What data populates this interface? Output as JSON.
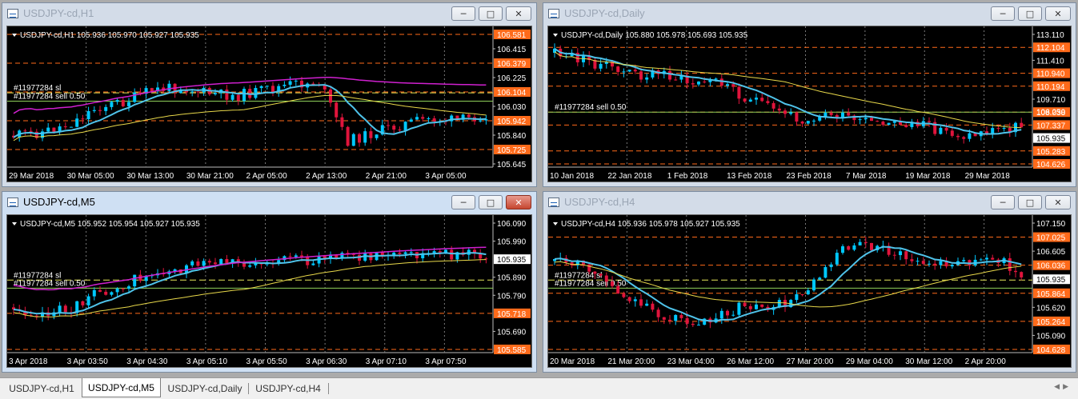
{
  "windows": [
    {
      "title": "USDJPY-cd,H1",
      "active": false,
      "info": "USDJPY-cd,H1  105.936 105.970 105.927 105.935",
      "price_labels": [
        "106.581",
        "106.415",
        "106.379",
        "106.225",
        "106.104",
        "106.030",
        "105.942",
        "105.840",
        "105.725",
        "105.645"
      ],
      "price_label_kinds": [
        "box",
        "plain",
        "box",
        "plain",
        "box",
        "plain",
        "box",
        "plain",
        "box",
        "plain"
      ],
      "time_labels": [
        "29 Mar 2018",
        "30 Mar 05:00",
        "30 Mar 13:00",
        "30 Mar 21:00",
        "2 Apr 05:00",
        "2 Apr 13:00",
        "2 Apr 21:00",
        "3 Apr 05:00"
      ],
      "order_lines": [
        "#11977284 sl",
        "#11977284 sell 0.50"
      ],
      "seed": 11,
      "trend": [
        0.85,
        0.82,
        0.75,
        0.6,
        0.55,
        0.45,
        0.42,
        0.48,
        0.5,
        0.45,
        0.4,
        0.38,
        0.9,
        0.82,
        0.75,
        0.7,
        0.72,
        0.66
      ]
    },
    {
      "title": "USDJPY-cd,Daily",
      "active": false,
      "info": "USDJPY-cd,Daily  105.880 105.978 105.693 105.935",
      "price_labels": [
        "113.110",
        "112.104",
        "111.410",
        "110.940",
        "110.194",
        "109.710",
        "108.038",
        "107.337",
        "105.935",
        "105.283",
        "104.626"
      ],
      "price_label_kinds": [
        "plain",
        "box",
        "plain",
        "box",
        "box",
        "plain",
        "box",
        "box",
        "white",
        "box",
        "box"
      ],
      "extra_labels": [
        "106.250"
      ],
      "time_labels": [
        "10 Jan 2018",
        "22 Jan 2018",
        "1 Feb 2018",
        "13 Feb 2018",
        "23 Feb 2018",
        "7 Mar 2018",
        "19 Mar 2018",
        "29 Mar 2018"
      ],
      "order_lines": [
        "#11977284 sell 0.50"
      ],
      "seed": 23,
      "trend": [
        0.12,
        0.18,
        0.25,
        0.32,
        0.3,
        0.4,
        0.36,
        0.52,
        0.62,
        0.7,
        0.66,
        0.72,
        0.76,
        0.74,
        0.8,
        0.86,
        0.8,
        0.76
      ]
    },
    {
      "title": "USDJPY-cd,M5",
      "active": true,
      "info": "USDJPY-cd,M5  105.952 105.954 105.927 105.935",
      "price_labels": [
        "106.090",
        "105.990",
        "105.935",
        "105.890",
        "105.790",
        "105.718",
        "105.690",
        "105.585"
      ],
      "price_label_kinds": [
        "plain",
        "plain",
        "white",
        "plain",
        "plain",
        "box",
        "plain",
        "box"
      ],
      "time_labels": [
        "3 Apr 2018",
        "3 Apr 03:50",
        "3 Apr 04:30",
        "3 Apr 05:10",
        "3 Apr 05:50",
        "3 Apr 06:30",
        "3 Apr 07:10",
        "3 Apr 07:50"
      ],
      "order_lines": [
        "#11977284 sl",
        "#11977284 sell 0.50"
      ],
      "seed": 37,
      "trend": [
        0.72,
        0.78,
        0.74,
        0.6,
        0.5,
        0.42,
        0.36,
        0.34,
        0.32,
        0.3,
        0.3,
        0.28,
        0.26,
        0.25,
        0.26,
        0.24,
        0.25,
        0.24
      ]
    },
    {
      "title": "USDJPY-cd,H4",
      "active": false,
      "info": "USDJPY-cd,H4  105.936 105.978 105.927 105.935",
      "price_labels": [
        "107.150",
        "107.025",
        "106.605",
        "106.036",
        "105.935",
        "105.864",
        "105.620",
        "105.264",
        "105.090",
        "104.628"
      ],
      "price_label_kinds": [
        "plain",
        "box",
        "plain",
        "box",
        "white",
        "box",
        "plain",
        "box",
        "plain",
        "box"
      ],
      "time_labels": [
        "20 Mar 2018",
        "21 Mar 20:00",
        "23 Mar 04:00",
        "26 Mar 12:00",
        "27 Mar 20:00",
        "29 Mar 04:00",
        "30 Mar 12:00",
        "2 Apr 20:00"
      ],
      "order_lines": [
        "#11977284 sl",
        "#11977284 sell 0.50"
      ],
      "seed": 53,
      "trend": [
        0.3,
        0.35,
        0.5,
        0.7,
        0.8,
        0.85,
        0.8,
        0.7,
        0.72,
        0.6,
        0.3,
        0.1,
        0.2,
        0.3,
        0.35,
        0.32,
        0.25,
        0.45
      ]
    }
  ],
  "tabs": [
    "USDJPY-cd,H1",
    "USDJPY-cd,M5",
    "USDJPY-cd,Daily",
    "USDJPY-cd,H4"
  ],
  "active_tab": 1,
  "colors": {
    "bull": "#00c8ff",
    "bear": "#e0143c",
    "ma_fast": "#4fc3ea",
    "ma_slow": "#e8d84a",
    "ma_long": "#d020d0",
    "grid": "#7a7a7a",
    "hline": "#ff6a1a",
    "order": "#e8e85a",
    "text": "#ffffff"
  }
}
